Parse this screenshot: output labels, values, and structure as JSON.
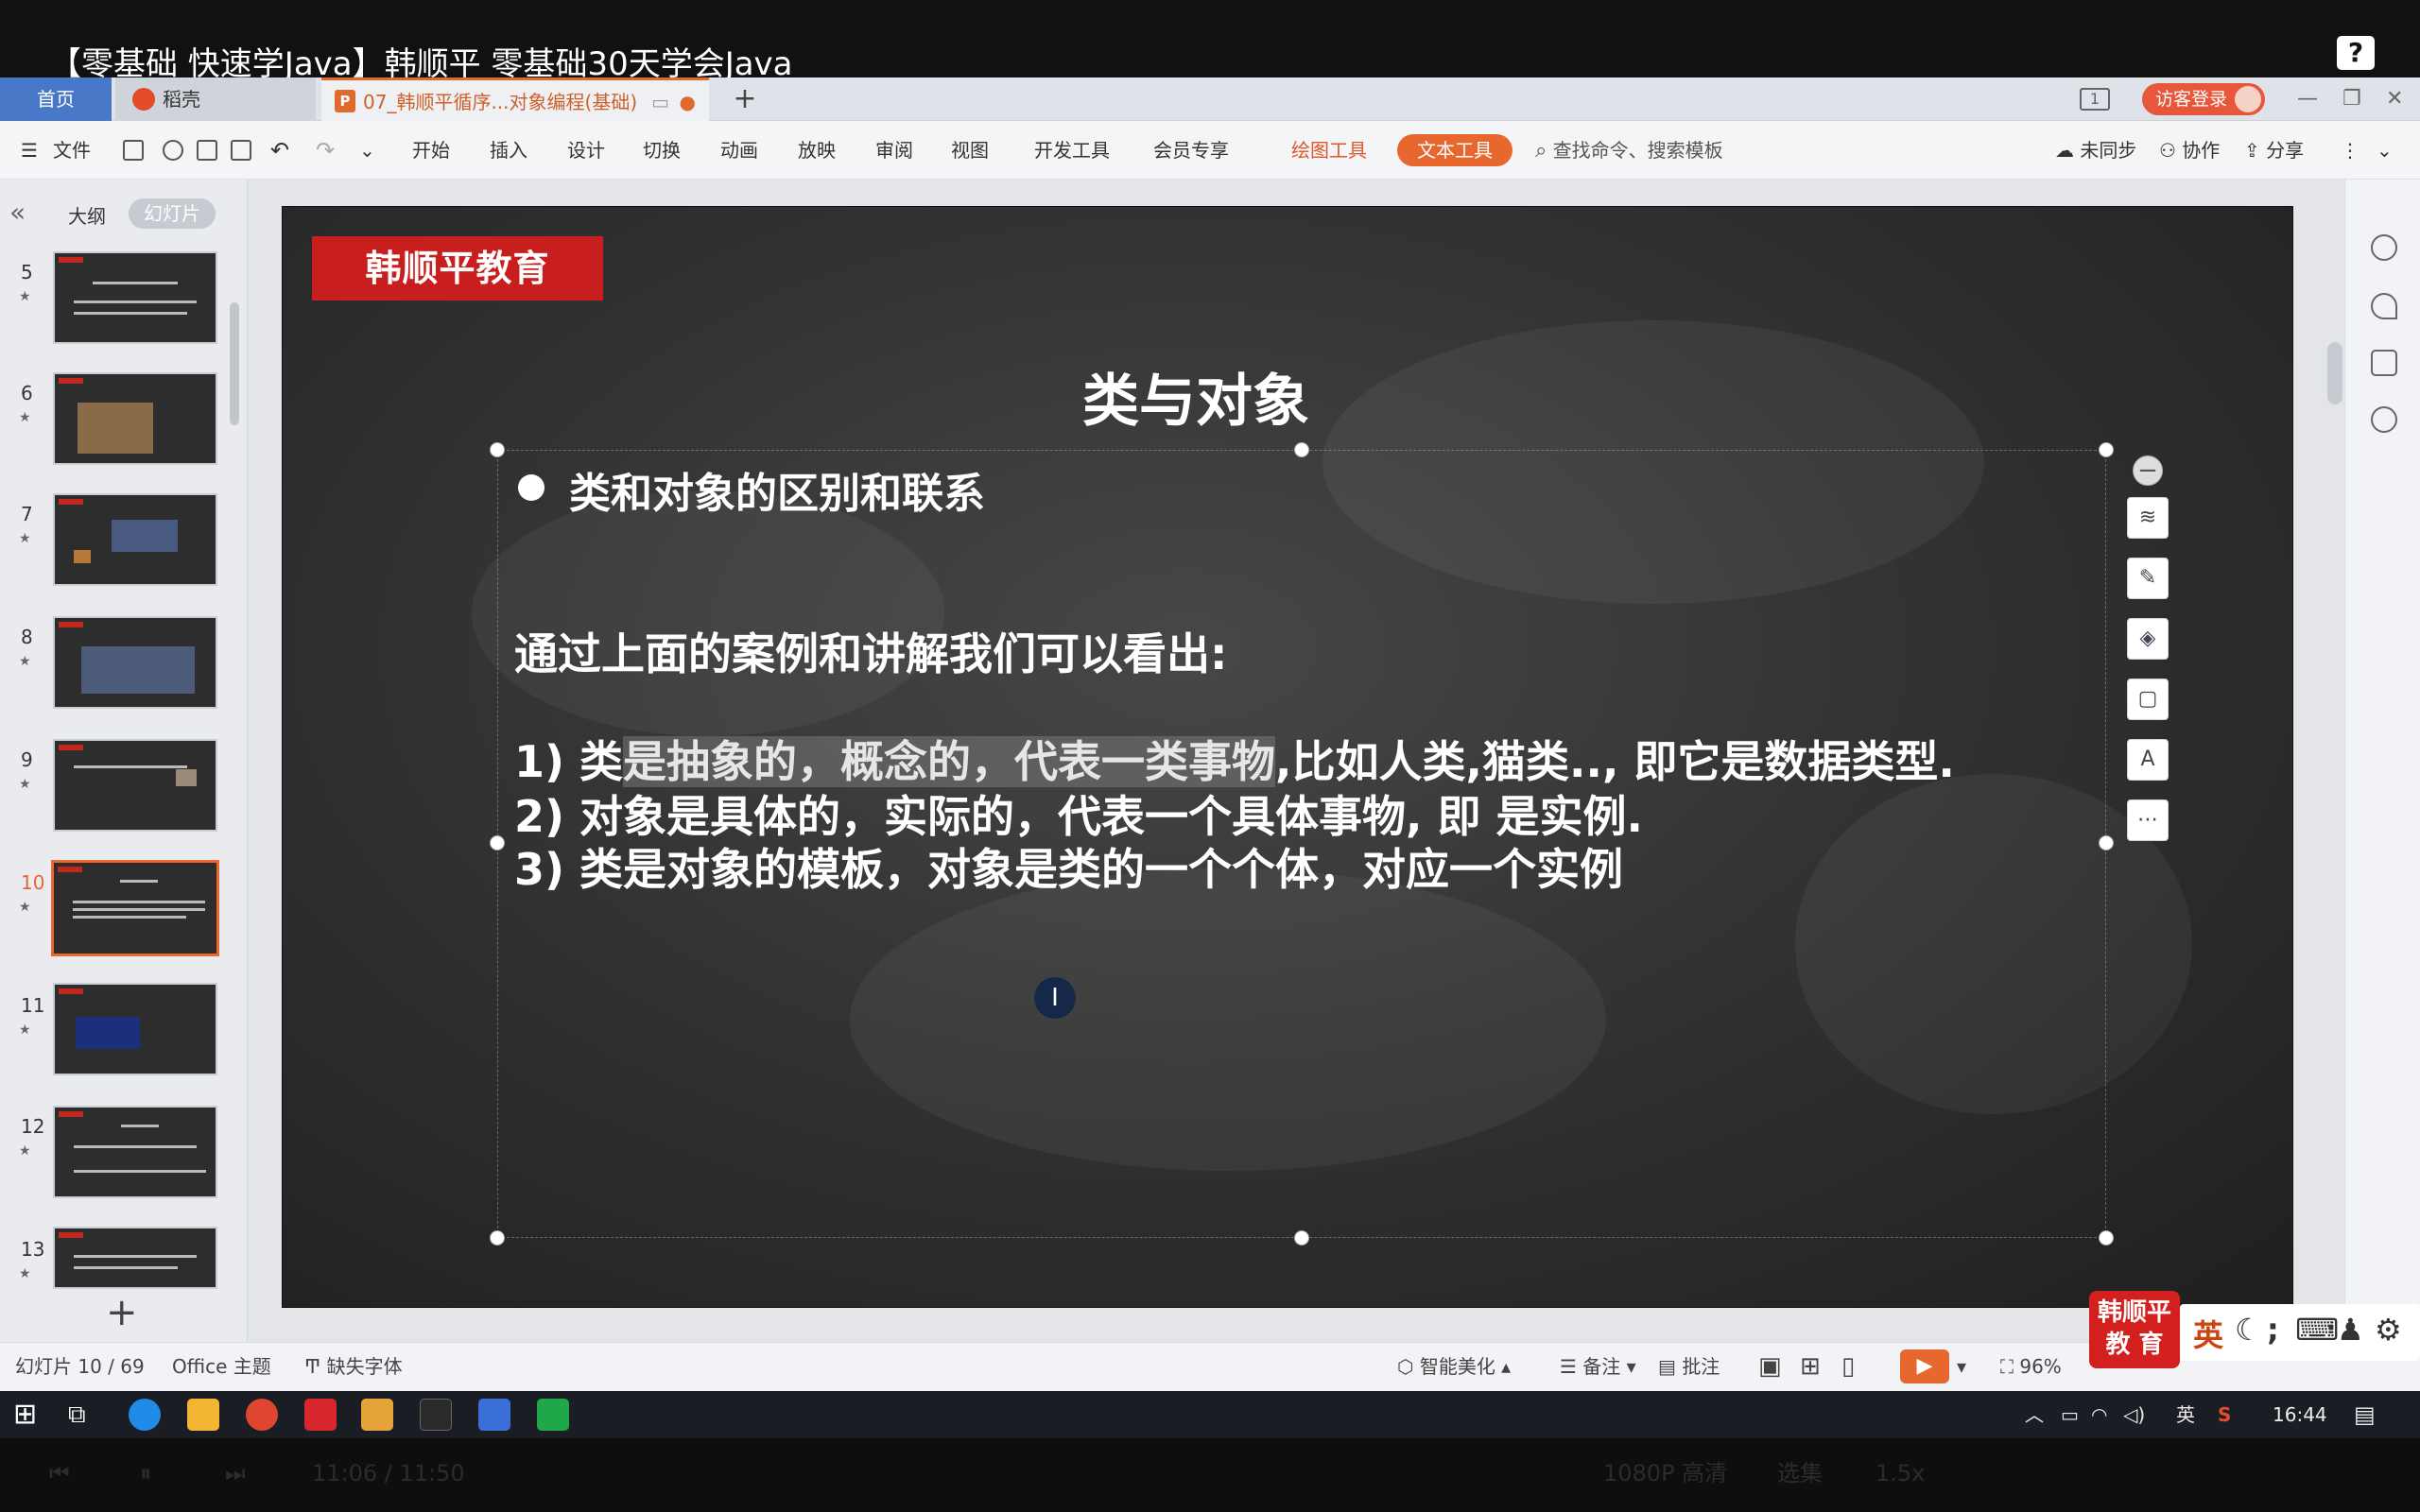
{
  "video": {
    "title": "【零基础 快速学Java】韩顺平 零基础30天学会Java",
    "help": "?"
  },
  "tabs": {
    "home": "首页",
    "daoke": "稻壳",
    "doc": "07_韩顺平循序...对象编程(基础)",
    "add": "+"
  },
  "window": {
    "page_indicator": "1",
    "guest_login": "访客登录",
    "minimize": "—",
    "maximize": "❐",
    "close": "✕"
  },
  "ribbon": {
    "file": "文件",
    "items": [
      "开始",
      "插入",
      "设计",
      "切换",
      "动画",
      "放映",
      "审阅",
      "视图",
      "开发工具",
      "会员专享"
    ],
    "drawing_tools": "绘图工具",
    "text_tools": "文本工具",
    "search_placeholder": "查找命令、搜索模板",
    "unsynced": "未同步",
    "collab": "协作",
    "share": "分享"
  },
  "panel": {
    "outline": "大纲",
    "slides": "幻灯片",
    "thumbs": [
      "5",
      "6",
      "7",
      "8",
      "9",
      "10",
      "11",
      "12",
      "13"
    ],
    "active": "10"
  },
  "slide": {
    "brand": "韩顺平教育",
    "title": "类与对象",
    "bullet": "类和对象的区别和联系",
    "intro": "通过上面的案例和讲解我们可以看出:",
    "line1_prefix": "1) 类",
    "line1_highlight": "是抽象的，概念的，代表一类事物",
    "line1_suffix": ",比如人类,猫类.., 即它是数据类型.",
    "line2": "2) 对象是具体的，实际的，代表一个具体事物, 即 是实例.",
    "line3": "3) 类是对象的模板，对象是类的一个个体，对应一个实例",
    "cursor": "I"
  },
  "status": {
    "slide_count": "幻灯片 10 / 69",
    "theme": "Office 主题",
    "missing_font": "缺失字体",
    "smart_beautify": "智能美化",
    "notes": "备注",
    "comments": "批注",
    "zoom": "96%"
  },
  "watermark": {
    "brand_line1": "韩顺平",
    "brand_line2": "教 育",
    "ime_lang": "英"
  },
  "taskbar": {
    "ime": "英",
    "time": "16:44"
  },
  "video_controls": {
    "time": "11:06 / 11:50",
    "quality": "1080P 高清",
    "select": "选集",
    "speed": "1.5x"
  }
}
